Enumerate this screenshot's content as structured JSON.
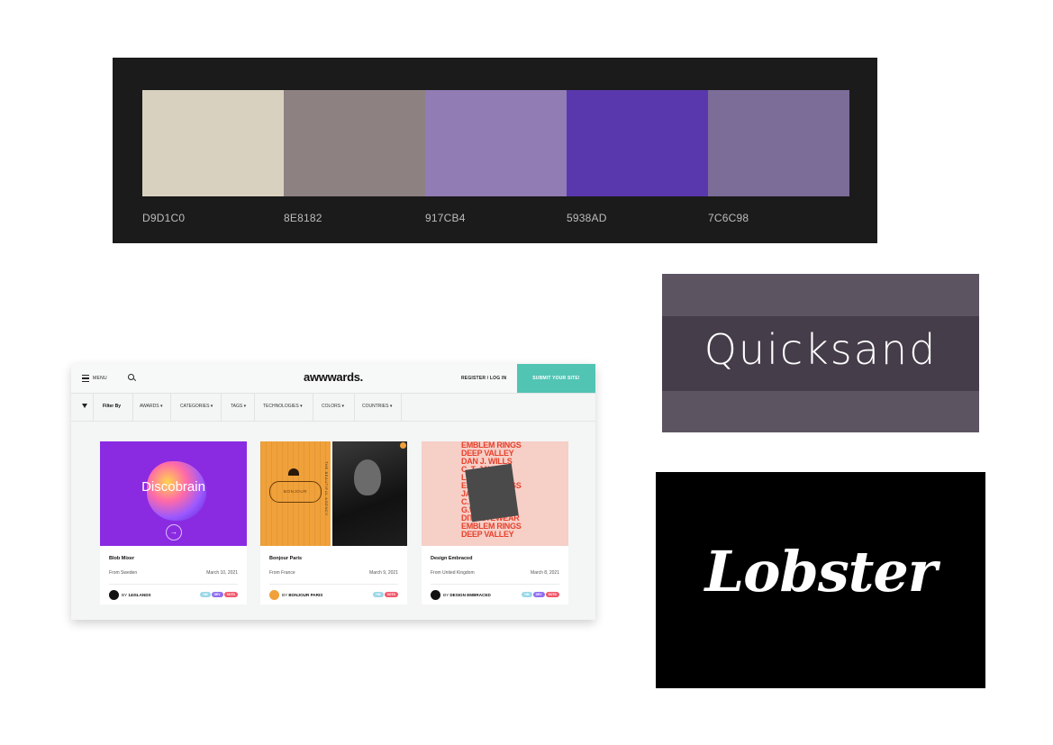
{
  "palette": {
    "swatches": [
      {
        "hex": "#D9D1C0",
        "label": "D9D1C0"
      },
      {
        "hex": "#8E8182",
        "label": "8E8182"
      },
      {
        "hex": "#917CB4",
        "label": "917CB4"
      },
      {
        "hex": "#5938AD",
        "label": "5938AD"
      },
      {
        "hex": "#7C6C98",
        "label": "7C6C98"
      }
    ]
  },
  "fonts": {
    "quicksand": "Quicksand",
    "lobster": "Lobster"
  },
  "awwwards": {
    "menu_label": "MENU",
    "logo": "awwwards.",
    "register": "REGISTER / LOG IN",
    "submit": "SUBMIT YOUR SITE!",
    "filter_by": "Filter By",
    "filters": [
      "AWARDS ▾",
      "CATEGORIES ▾",
      "TAGS ▾",
      "TECHNOLOGIES ▾",
      "COLORS ▾",
      "COUNTRIES ▾"
    ],
    "cards": [
      {
        "thumb_text": "Discobrain",
        "title": "Blob Mixer",
        "from": "From Sweden",
        "date": "March 10, 2021",
        "by": "BY",
        "author": "14ISLANDS",
        "badges": [
          {
            "label": "HM",
            "color": "#9ad7e8"
          },
          {
            "label": "DEV",
            "color": "#8f6cf0"
          },
          {
            "label": "SOTD",
            "color": "#f2566b"
          }
        ]
      },
      {
        "thumb_text": "BONJOUR",
        "thumb_vertical": "THE BEAUTIFUL AGENCY",
        "title": "Bonjour Paris",
        "from": "From France",
        "date": "March 9, 2021",
        "by": "BY",
        "author": "BONJOUR PARIS",
        "badges": [
          {
            "label": "HM",
            "color": "#9ad7e8"
          },
          {
            "label": "SOTD",
            "color": "#f2566b"
          }
        ]
      },
      {
        "thumb_lines": [
          "EMBLEM RINGS",
          "DEEP VALLEY",
          "DAN J. WILLS",
          "C. T. JAVIN",
          "LISTA RIBUK",
          "EMBLEM RINGS",
          "JAGNAE",
          "C. T. JAVIN",
          "G.W.DINNIK",
          "DITA EYEWEAR",
          "EMBLEM RINGS",
          "DEEP VALLEY"
        ],
        "title": "Design Embraced",
        "from": "From United Kingdom",
        "date": "March 8, 2021",
        "by": "BY",
        "author": "DESIGN EMBRACED",
        "badges": [
          {
            "label": "HM",
            "color": "#9ad7e8"
          },
          {
            "label": "DEV",
            "color": "#8f6cf0"
          },
          {
            "label": "SOTD",
            "color": "#f2566b"
          }
        ]
      }
    ]
  }
}
